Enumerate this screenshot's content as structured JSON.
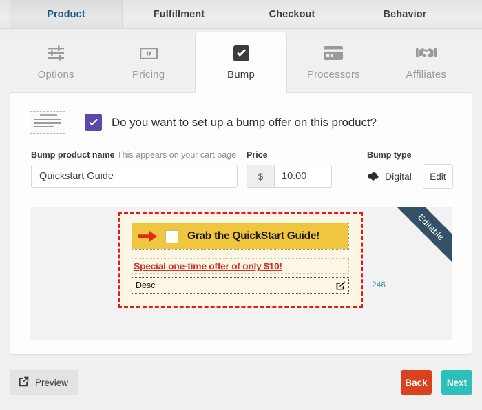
{
  "top_nav": {
    "tabs": [
      {
        "label": "Product",
        "active": true
      },
      {
        "label": "Fulfillment",
        "active": false
      },
      {
        "label": "Checkout",
        "active": false
      },
      {
        "label": "Behavior",
        "active": false
      }
    ]
  },
  "sub_nav": {
    "tabs": [
      {
        "label": "Options",
        "icon": "sliders-icon",
        "active": false
      },
      {
        "label": "Pricing",
        "icon": "banknote-icon",
        "active": false
      },
      {
        "label": "Bump",
        "icon": "checkbox-checked-icon",
        "active": true
      },
      {
        "label": "Processors",
        "icon": "credit-card-icon",
        "active": false
      },
      {
        "label": "Affiliates",
        "icon": "handshake-icon",
        "active": false
      }
    ]
  },
  "card": {
    "header": {
      "doc_icon": "document-lines-icon",
      "checkbox_checked": true,
      "question": "Do you want to set up a bump offer on this product?"
    },
    "fields": {
      "bump_name": {
        "label": "Bump product name",
        "hint": "This appears on your cart page",
        "value": "Quickstart Guide",
        "placeholder": ""
      },
      "price": {
        "label": "Price",
        "currency_symbol": "$",
        "value": "10.00",
        "placeholder": ""
      },
      "bump_type": {
        "label": "Bump type",
        "icon": "cloud-download-icon",
        "value": "Digital",
        "edit_label": "Edit"
      }
    },
    "preview": {
      "ribbon_label": "Editable",
      "bump_offer": {
        "arrow_icon": "red-arrow-right-icon",
        "checkbox_checked": false,
        "headline": "Grab the QuickStart Guide!",
        "subheadline": "Special one-time offer of only $10!",
        "description_value": "Desc",
        "description_edit_icon": "pencil-square-icon"
      },
      "char_count": "246"
    }
  },
  "footer": {
    "preview_label": "Preview",
    "preview_icon": "external-link-icon",
    "back_label": "Back",
    "next_label": "Next",
    "colors": {
      "back": "#d9411f",
      "next": "#2ebfba",
      "checkbox": "#5a48ab",
      "ribbon": "#345064",
      "bump_bar": "#f0c63f",
      "bump_border": "#e01b1b",
      "char_count": "#3f9a96"
    }
  }
}
